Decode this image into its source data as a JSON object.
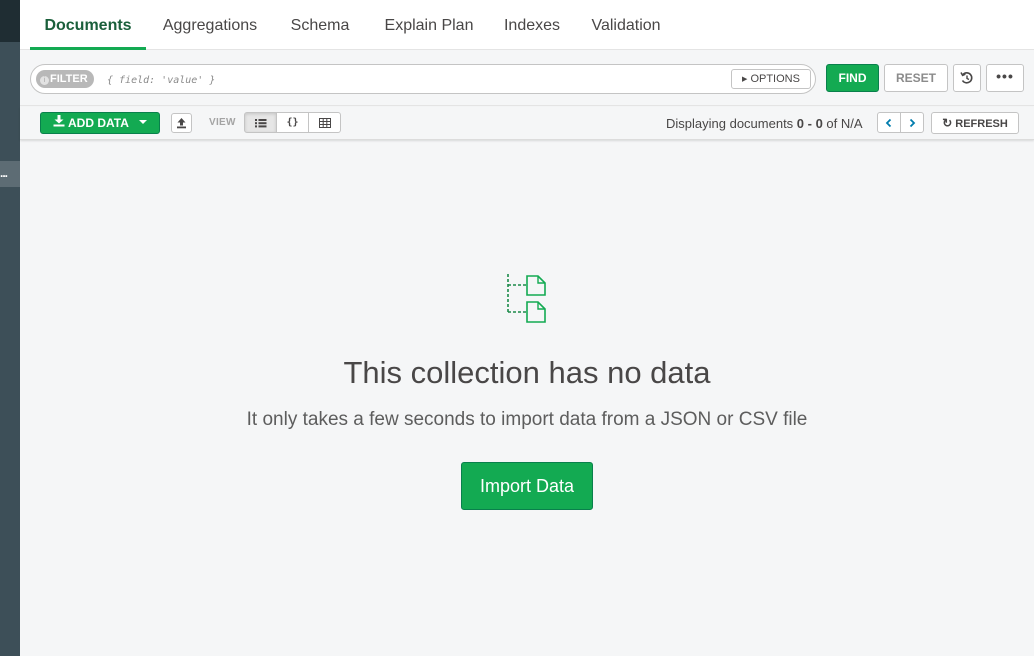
{
  "tabs": [
    {
      "label": "Documents",
      "active": true
    },
    {
      "label": "Aggregations",
      "active": false
    },
    {
      "label": "Schema",
      "active": false
    },
    {
      "label": "Explain Plan",
      "active": false
    },
    {
      "label": "Indexes",
      "active": false
    },
    {
      "label": "Validation",
      "active": false
    }
  ],
  "sidebar": {
    "menu_glyph": "..."
  },
  "query_bar": {
    "filter_label": "FILTER",
    "filter_placeholder": "{ field: 'value' }",
    "options_label": "OPTIONS",
    "find_label": "FIND",
    "reset_label": "RESET",
    "more_label": "•••"
  },
  "toolbar": {
    "add_data_label": "ADD DATA",
    "view_label": "VIEW",
    "view_modes": [
      "list",
      "json",
      "table"
    ],
    "active_view": "list",
    "displaying_prefix": "Displaying documents ",
    "range": "0 - 0",
    "of_text": " of N/A",
    "refresh_label": "REFRESH"
  },
  "empty_state": {
    "title": "This collection has no data",
    "subtitle": "It only takes a few seconds to import data from a JSON or CSV file",
    "button_label": "Import Data"
  },
  "colors": {
    "accent_green": "#13aa52",
    "active_tab_text": "#1a5f3b",
    "sidebar": "#3d4f58",
    "pager_icon": "#007cad"
  }
}
